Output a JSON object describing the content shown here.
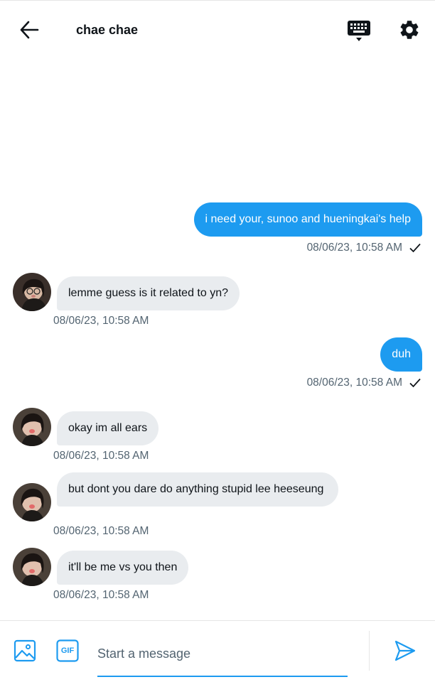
{
  "header": {
    "title": "chae chae",
    "back_icon": "arrow-left-icon",
    "keyboard_icon": "keyboard-icon",
    "settings_icon": "gear-icon"
  },
  "messages": [
    {
      "direction": "outgoing",
      "text": "i need your, sunoo and hueningkai's help",
      "timestamp": "08/06/23, 10:58 AM",
      "status": "sent"
    },
    {
      "direction": "incoming",
      "text": "lemme guess is it related to yn?",
      "timestamp": "08/06/23, 10:58 AM"
    },
    {
      "direction": "outgoing",
      "text": "duh",
      "timestamp": "08/06/23, 10:58 AM",
      "status": "sent"
    },
    {
      "direction": "incoming",
      "text": "okay im all ears",
      "timestamp": "08/06/23, 10:58 AM"
    },
    {
      "direction": "incoming",
      "text": "but dont you dare do anything stupid lee heeseung",
      "timestamp": "08/06/23, 10:58 AM"
    },
    {
      "direction": "incoming",
      "text": "it'll be me vs you then",
      "timestamp": "08/06/23, 10:58 AM"
    }
  ],
  "composer": {
    "placeholder": "Start a message",
    "gif_label": "GIF",
    "image_icon": "image-icon",
    "send_icon": "send-icon"
  },
  "colors": {
    "accent": "#1d9bf0",
    "incoming_bubble": "#e9ecef",
    "timestamp": "#536471"
  }
}
